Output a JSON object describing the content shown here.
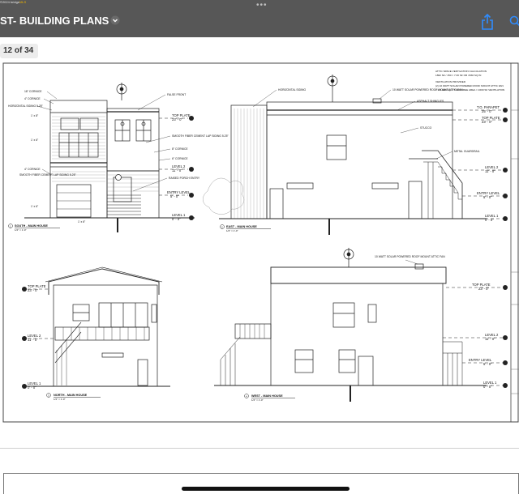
{
  "app": {
    "title": "ST- BUILDING PLANS",
    "watermark_prefix": "©2024 bridge",
    "watermark_mls": "MLS"
  },
  "pager": {
    "label": "12 of 34"
  },
  "plan": {
    "views": {
      "south": {
        "title": "SOUTH - MAIN HOUSE",
        "scale": "1/4\" = 1'-0\"",
        "number": "1"
      },
      "east": {
        "title": "EAST - MAIN HOUSE",
        "scale": "1/4\" = 1'-0\"",
        "number": "2"
      },
      "north": {
        "title": "NORTH - MAIN HOUSE",
        "scale": "1/4\" = 1'-0\"",
        "number": "3"
      },
      "west": {
        "title": "WEST - MAIN HOUSE",
        "scale": "1/4\" = 1'-0\"",
        "number": "4"
      }
    },
    "levels": {
      "top_plate": "TOP PLATE",
      "top_plate_elev": "23' - 0\"",
      "level2": "LEVEL 2",
      "level2_elev": "11' - 0\"",
      "entry": "ENTRY LEVEL",
      "entry_elev": "5' - 0\"",
      "level1": "LEVEL 1",
      "level1_elev": "0' - 0\"",
      "parapet": "T.O. PARAPET",
      "parapet_elev": "25' - 0\""
    },
    "south_notes": {
      "cornice_18": "18\" CORNICE",
      "cornice_4": "4\" CORNICE",
      "horiz_siding": "HORIZONTAL SIDING 5.25\"",
      "false_front": "FALSE FRONT",
      "smooth_fiber": "SMOOTH FIBER CEMENT LAP SIDING 5.25\"",
      "cornice_8": "8\" CORNICE",
      "cornice_6": "6\" CORNICE",
      "cornice_4b": "4\" CORNICE",
      "smooth_fiber2": "SMOOTH FIBER CEMENT LAP SIDING 5.25\"",
      "raised_porch": "RAISED PORCH ENTRY",
      "dim_1": "1' x 8\"",
      "dim_2": "1' x 6\"",
      "dim_3": "1' x 6\"",
      "dim_4": "1' x 6\""
    },
    "east_notes": {
      "horiz_siding": "HORIZONTAL SIDING",
      "solar_fan": "10 WATT SOLAR POWERED ROOF MOUNT ATTIC FAN",
      "asphalt": "ASPHALT SHINGLES",
      "stucco": "STUCCO",
      "guardrail": "METAL GUARDRAIL"
    },
    "attic": {
      "title": "ATTIC SPACE VENTILATION CALCULATION",
      "line1": "1862 SF / 150 = 7.30 SF OR 1530 SQ IN",
      "provided": "VENTILATION PROVIDED",
      "line2": "(2) 10 WATT SOLAR POWERED ROOF MOUNT ATTIC FAN",
      "line3": "= 2 X 800 SQ. FT NET FREE AREA = 1600 SF VENTILATION"
    },
    "west_notes": {
      "solar_fan": "10 WATT SOLAR POWERED ROOF MOUNT ATTIC FAN"
    }
  }
}
